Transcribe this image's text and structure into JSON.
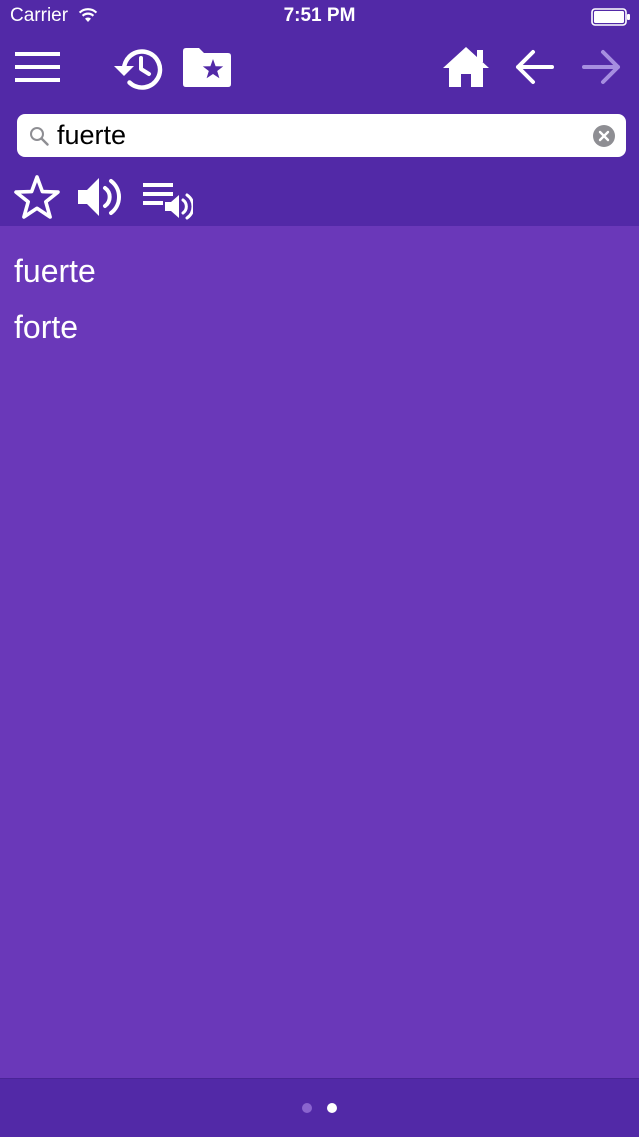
{
  "status_bar": {
    "carrier": "Carrier",
    "time": "7:51 PM"
  },
  "toolbar": {
    "icons": [
      "menu-icon",
      "history-icon",
      "favorites-folder-icon",
      "home-icon",
      "back-arrow-icon",
      "forward-arrow-icon"
    ],
    "forward_enabled": false
  },
  "search": {
    "value": "fuerte",
    "placeholder": ""
  },
  "actions": {
    "icons": [
      "star-icon",
      "speaker-icon",
      "playlist-audio-icon"
    ]
  },
  "results": {
    "word": "fuerte",
    "translation": "forte"
  },
  "pager": {
    "page_count": 2,
    "current_page": 2
  },
  "colors": {
    "toolbar_bg": "#5229a7",
    "content_bg": "#6a38b9",
    "text": "#ffffff",
    "disabled_icon": "#a68ee0"
  }
}
